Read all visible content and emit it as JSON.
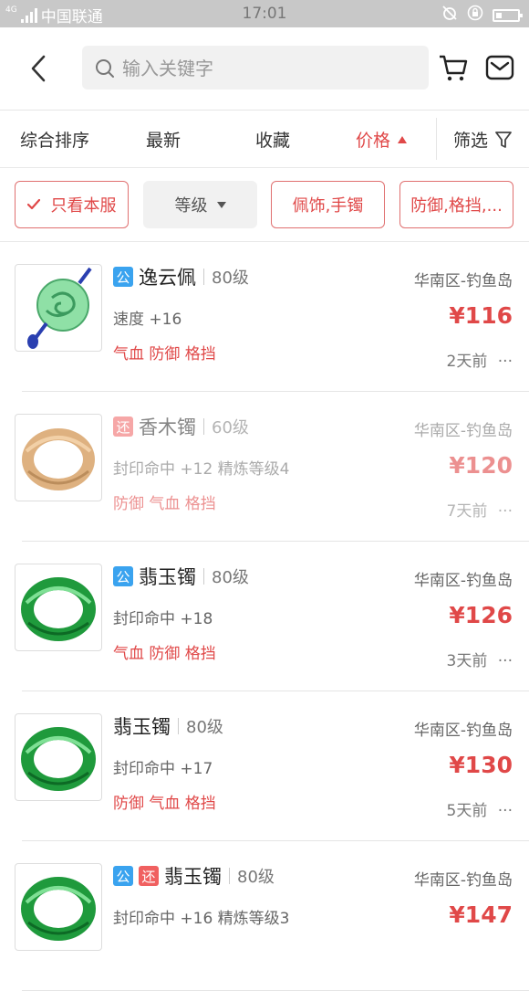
{
  "status": {
    "network": "4G",
    "carrier": "中国联通",
    "time": "17:01"
  },
  "search": {
    "placeholder": "输入关键字"
  },
  "sort": {
    "comprehensive": "综合排序",
    "newest": "最新",
    "favorites": "收藏",
    "price": "价格",
    "filter": "筛选"
  },
  "filters": {
    "server_only": "只看本服",
    "level": "等级",
    "category": "佩饰,手镯",
    "stats": "防御,格挡,..."
  },
  "items": [
    {
      "badges": [
        "公"
      ],
      "name": "逸云佩",
      "level": "80级",
      "attr": "速度 +16",
      "tags": "气血 防御 格挡",
      "server": "华南区-钓鱼岛",
      "price": "¥116",
      "time": "2天前",
      "more": "···",
      "faded": false,
      "image": "jade-pendant"
    },
    {
      "badges": [
        "还"
      ],
      "name": "香木镯",
      "level": "60级",
      "attr": "封印命中 +12 精炼等级4",
      "tags": "防御 气血 格挡",
      "server": "华南区-钓鱼岛",
      "price": "¥120",
      "time": "7天前",
      "more": "···",
      "faded": true,
      "image": "wood-bracelet"
    },
    {
      "badges": [
        "公"
      ],
      "name": "翡玉镯",
      "level": "80级",
      "attr": "封印命中 +18",
      "tags": "气血 防御 格挡",
      "server": "华南区-钓鱼岛",
      "price": "¥126",
      "time": "3天前",
      "more": "···",
      "faded": false,
      "image": "jade-bracelet"
    },
    {
      "badges": [],
      "name": "翡玉镯",
      "level": "80级",
      "attr": "封印命中 +17",
      "tags": "防御 气血 格挡",
      "server": "华南区-钓鱼岛",
      "price": "¥130",
      "time": "5天前",
      "more": "···",
      "faded": false,
      "image": "jade-bracelet"
    },
    {
      "badges": [
        "公",
        "还"
      ],
      "name": "翡玉镯",
      "level": "80级",
      "attr": "封印命中 +16 精炼等级3",
      "tags": "",
      "server": "华南区-钓鱼岛",
      "price": "¥147",
      "time": "",
      "more": "",
      "faded": false,
      "image": "jade-bracelet"
    }
  ],
  "colors": {
    "accent": "#e04848",
    "badge_public": "#3aa3ef",
    "badge_return": "#f06060"
  }
}
